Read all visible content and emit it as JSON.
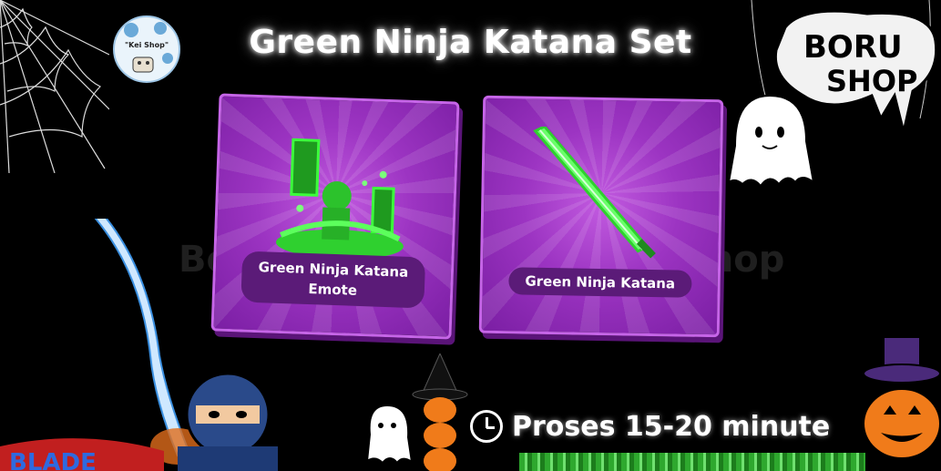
{
  "title": "Green Ninja Katana Set",
  "logo": {
    "text": "\"Kei Shop\""
  },
  "brand": {
    "line1": "BORU",
    "line2": "SHOP"
  },
  "watermark": {
    "left": "Boru",
    "right": "Shop"
  },
  "cards": [
    {
      "label_line1": "Green Ninja Katana",
      "label_line2": "Emote",
      "icon": "emote-icon"
    },
    {
      "label": "Green Ninja Katana",
      "icon": "katana-icon"
    }
  ],
  "status": {
    "text": "Proses 15-20 minute",
    "icon": "clock-icon"
  },
  "colors": {
    "card_purple": "#9c34c2",
    "label_bg": "#5b1b78",
    "glow_green": "#3cff3c"
  }
}
